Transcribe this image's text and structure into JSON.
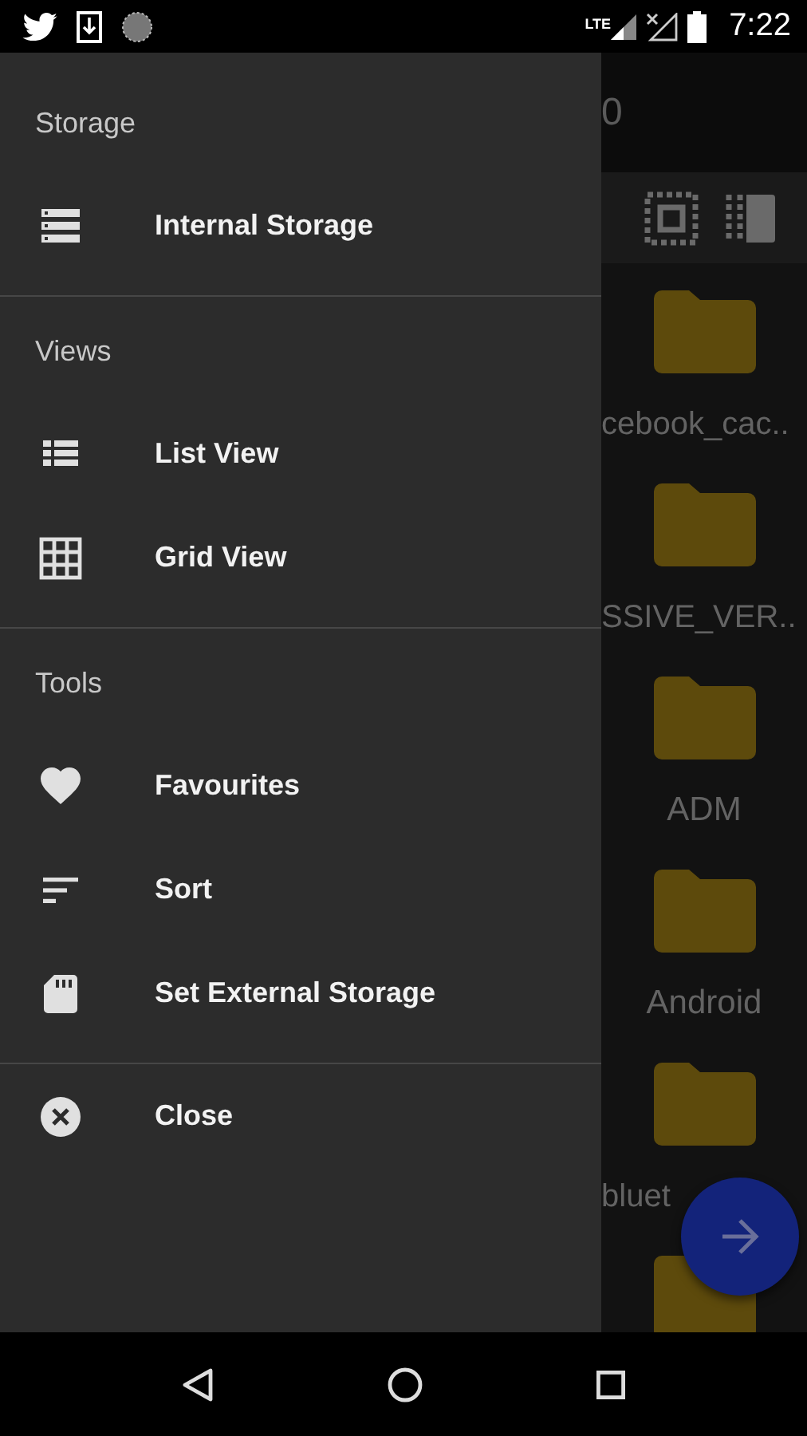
{
  "status_bar": {
    "network": "LTE",
    "time": "7:22"
  },
  "drawer": {
    "sections": [
      {
        "header": "Storage",
        "items": [
          {
            "label": "Internal Storage"
          }
        ]
      },
      {
        "header": "Views",
        "items": [
          {
            "label": "List View"
          },
          {
            "label": "Grid View"
          }
        ]
      },
      {
        "header": "Tools",
        "items": [
          {
            "label": "Favourites"
          },
          {
            "label": "Sort"
          },
          {
            "label": "Set External Storage"
          }
        ]
      },
      {
        "items": [
          {
            "label": "Close"
          }
        ]
      }
    ]
  },
  "background": {
    "toolbar_title": "0",
    "folders": [
      {
        "kind": "folder",
        "label": "cebook_cac..",
        "cut_left": true
      },
      {
        "kind": "folder",
        "label": "SSIVE_VER..",
        "cut_left": true
      },
      {
        "kind": "folder",
        "label": "ADM"
      },
      {
        "kind": "folder",
        "label": "Android"
      },
      {
        "kind": "folder",
        "label": "bluet",
        "cut_left": true
      },
      {
        "kind": "folder"
      }
    ]
  }
}
